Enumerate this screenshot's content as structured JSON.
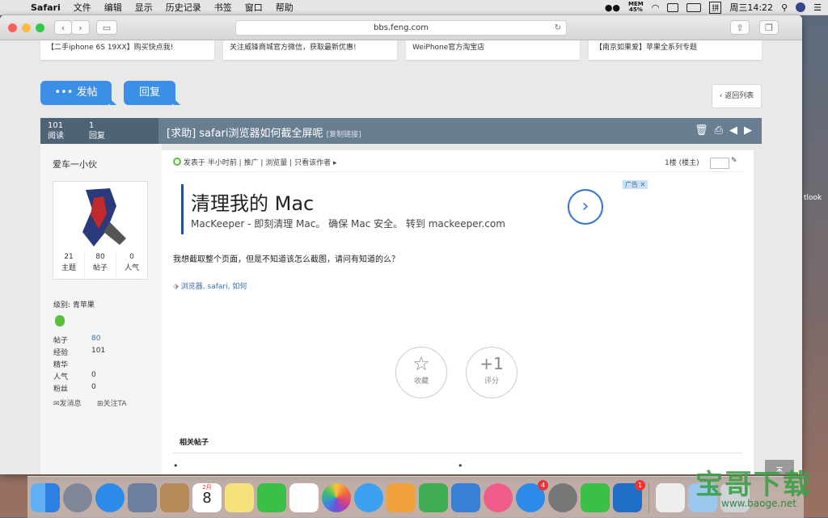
{
  "menubar": {
    "app_name": "Safari",
    "items": [
      "文件",
      "编辑",
      "显示",
      "历史记录",
      "书签",
      "窗口",
      "帮助"
    ],
    "mem_label": "MEM",
    "mem_value": "45%",
    "input_method": "拼",
    "clock": "周三14:22"
  },
  "browser": {
    "url": "bbs.feng.com"
  },
  "banners": [
    "【二手iphone 6S 19XX】购买快点我!",
    "关注威锋商城官方微信，获取最新优惠!",
    "WeiPhone官方淘宝店",
    "【南京如果爱】苹果全系列专题"
  ],
  "actions": {
    "post_label": "发帖",
    "reply_label": "回复",
    "back_label": "返回列表"
  },
  "thread": {
    "reads_count": "101",
    "reads_label": "阅读",
    "replies_count": "1",
    "replies_label": "回复",
    "title": "[求助] safari浏览器如何截全屏呢",
    "copy_link": "[复制链接]"
  },
  "author": {
    "name": "爱车一小伙",
    "topics_count": "21",
    "topics_label": "主题",
    "posts_count": "80",
    "posts_label": "帖子",
    "popularity_count": "0",
    "popularity_label": "人气",
    "level": "级别: 青苹果",
    "details": [
      {
        "label": "帖子",
        "value": "80"
      },
      {
        "label": "经验",
        "value": "101"
      },
      {
        "label": "精华",
        "value": ""
      },
      {
        "label": "人气",
        "value": "0"
      },
      {
        "label": "粉丝",
        "value": "0"
      }
    ],
    "message_label": "发消息",
    "follow_label": "关注TA"
  },
  "post": {
    "posted_time": "发表于 半小时前",
    "promote": "推广",
    "views": "浏览量",
    "only_author": "只看该作者",
    "floor": "1楼 (楼主)",
    "ad_title": "清理我的 Mac",
    "ad_text": "MacKeeper - 即刻清理 Mac。 确保 Mac 安全。 转到 mackeeper.com",
    "ad_badge": "广告",
    "body": "我想截取整个页面，但是不知道该怎么截图，请问有知道的么？",
    "tags": "浏览器, safari, 如何",
    "favorite_label": "收藏",
    "rate_symbol": "+1",
    "rate_label": "评分",
    "related_title": "相关帖子"
  },
  "side_fragment": "tlook",
  "watermark": {
    "main": "宝哥下载",
    "url": "www.baoge.net"
  },
  "dock": {
    "calendar_month": "2月",
    "calendar_day": "8",
    "badges": {
      "appstore": "4",
      "outlook": "1"
    }
  },
  "colors": {
    "accent_blue": "#3c8fe6",
    "thread_header": "#6a7e92"
  }
}
